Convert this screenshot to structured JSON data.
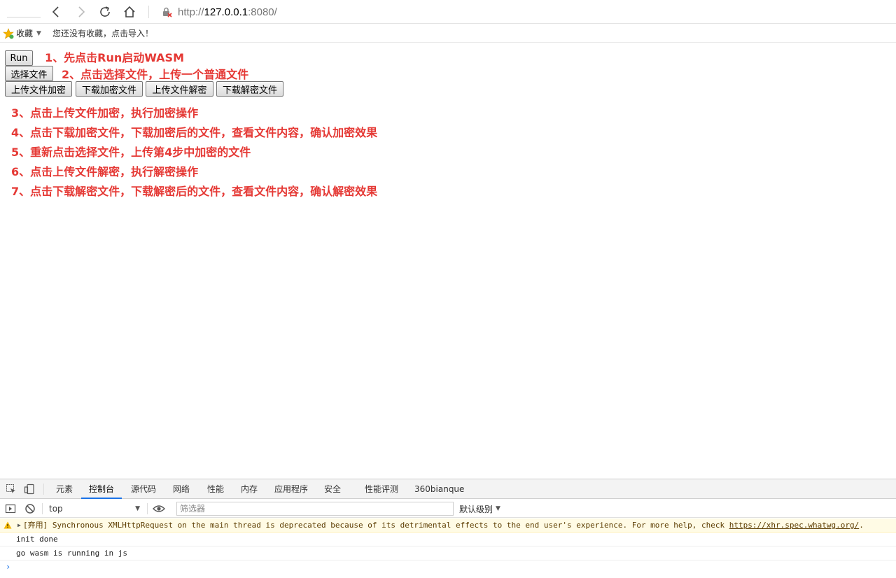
{
  "browser": {
    "url_scheme": "http://",
    "url_host": "127.0.0.1",
    "url_path": ":8080/",
    "bookmarks_label": "收藏",
    "bookmarks_hint": "您还没有收藏，点击导入！"
  },
  "page": {
    "run_button": "Run",
    "choose_file_button": "选择文件",
    "upload_encrypt_button": "上传文件加密",
    "download_encrypt_button": "下载加密文件",
    "upload_decrypt_button": "上传文件解密",
    "download_decrypt_button": "下载解密文件",
    "steps": [
      "1、先点击Run启动WASM",
      "2、点击选择文件，上传一个普通文件",
      "3、点击上传文件加密，执行加密操作",
      "4、点击下载加密文件，下载加密后的文件，查看文件内容，确认加密效果",
      "5、重新点击选择文件，上传第4步中加密的文件",
      "6、点击上传文件解密，执行解密操作",
      "7、点击下载解密文件，下载解密后的文件，查看文件内容，确认解密效果"
    ],
    "accent_color": "#e53935"
  },
  "devtools": {
    "tabs": [
      "元素",
      "控制台",
      "源代码",
      "网络",
      "性能",
      "内存",
      "应用程序",
      "安全",
      "性能评测",
      "360bianque"
    ],
    "active_tab": "控制台",
    "context": "top",
    "filter_placeholder": "筛选器",
    "level": "默认级别",
    "warning": {
      "tag": "[弃用]",
      "text": "Synchronous XMLHttpRequest on the main thread is deprecated because of its detrimental effects to the end user's experience. For more help, check ",
      "link": "https://xhr.spec.whatwg.org/",
      "tail": "."
    },
    "logs": [
      "init done",
      "go wasm is running in js"
    ],
    "prompt": "›"
  }
}
